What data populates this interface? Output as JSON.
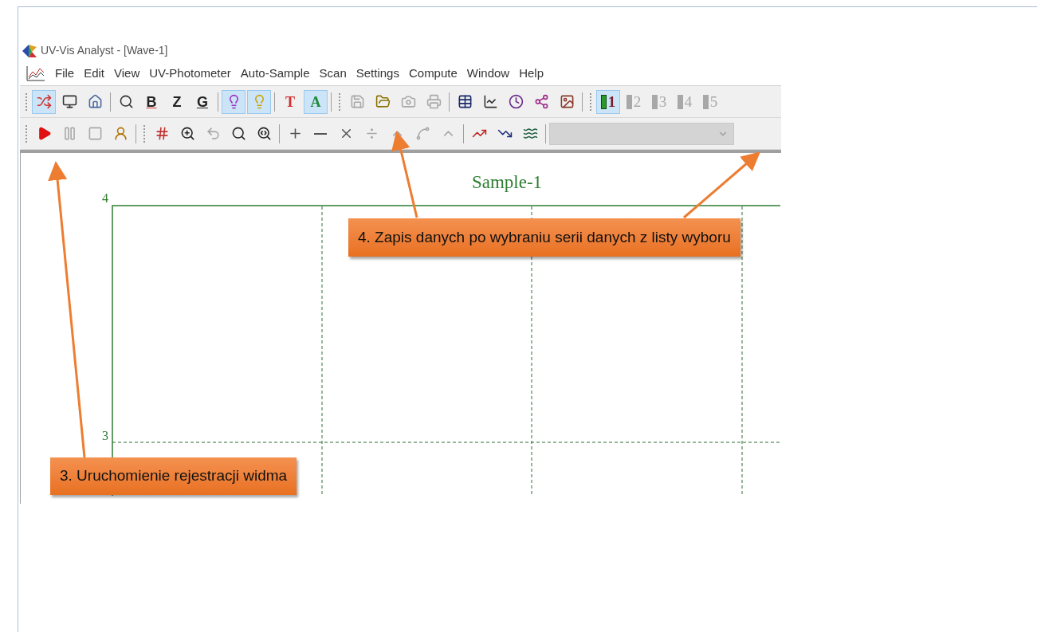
{
  "window": {
    "title": "UV-Vis Analyst - [Wave-1]"
  },
  "menu": [
    "File",
    "Edit",
    "View",
    "UV-Photometer",
    "Auto-Sample",
    "Scan",
    "Settings",
    "Compute",
    "Window",
    "Help"
  ],
  "toolbars": [
    {
      "groups": [
        {
          "grip": true,
          "items": [
            {
              "pressed": true,
              "disabled": false
            },
            {
              "pressed": false,
              "disabled": false
            },
            {
              "pressed": false,
              "disabled": false
            }
          ]
        },
        {
          "grip": false,
          "items": [
            {
              "pressed": false,
              "disabled": false
            },
            {
              "label": "B",
              "pressed": false,
              "disabled": false
            },
            {
              "label": "Z",
              "pressed": false,
              "disabled": false
            },
            {
              "label": "G",
              "pressed": false,
              "disabled": false
            }
          ]
        },
        {
          "grip": false,
          "items": [
            {
              "pressed": true,
              "disabled": false
            },
            {
              "pressed": true,
              "disabled": false
            }
          ]
        },
        {
          "grip": false,
          "items": [
            {
              "label": "T",
              "pressed": false,
              "disabled": false
            },
            {
              "label": "A",
              "pressed": true,
              "disabled": false
            }
          ]
        },
        {
          "grip": true,
          "items": [
            {
              "pressed": false,
              "disabled": true
            },
            {
              "pressed": false,
              "disabled": false
            },
            {
              "pressed": false,
              "disabled": true
            },
            {
              "pressed": false,
              "disabled": true
            }
          ]
        },
        {
          "grip": false,
          "items": [
            {
              "pressed": false,
              "disabled": false
            },
            {
              "pressed": false,
              "disabled": false
            },
            {
              "pressed": false,
              "disabled": false
            },
            {
              "pressed": false,
              "disabled": false
            },
            {
              "pressed": false,
              "disabled": false
            }
          ]
        },
        {
          "grip": true,
          "items": [
            {
              "label": "1",
              "pressed": true,
              "disabled": false
            },
            {
              "label": "2",
              "pressed": false,
              "disabled": true
            },
            {
              "label": "3",
              "pressed": false,
              "disabled": true
            },
            {
              "label": "4",
              "pressed": false,
              "disabled": true
            },
            {
              "label": "5",
              "pressed": false,
              "disabled": true
            }
          ]
        }
      ]
    },
    {
      "groups": [
        {
          "grip": true,
          "items": [
            {
              "pressed": false,
              "disabled": false
            },
            {
              "pressed": false,
              "disabled": true
            },
            {
              "pressed": false,
              "disabled": true
            },
            {
              "pressed": false,
              "disabled": false
            }
          ]
        },
        {
          "grip": true,
          "items": [
            {
              "pressed": false,
              "disabled": false
            },
            {
              "pressed": false,
              "disabled": false
            },
            {
              "pressed": false,
              "disabled": true
            },
            {
              "pressed": false,
              "disabled": false
            },
            {
              "pressed": false,
              "disabled": false
            }
          ]
        },
        {
          "grip": false,
          "items": [
            {
              "pressed": false,
              "disabled": false
            },
            {
              "pressed": false,
              "disabled": false
            },
            {
              "pressed": false,
              "disabled": false
            },
            {
              "pressed": false,
              "disabled": true
            },
            {
              "pressed": false,
              "disabled": true
            },
            {
              "pressed": false,
              "disabled": true
            },
            {
              "pressed": false,
              "disabled": true
            }
          ]
        },
        {
          "grip": false,
          "items": [
            {
              "pressed": false,
              "disabled": false
            },
            {
              "pressed": false,
              "disabled": false
            },
            {
              "pressed": false,
              "disabled": false
            }
          ]
        }
      ],
      "series_select": {
        "disabled": true
      }
    }
  ],
  "plot": {
    "title": "Sample-1",
    "y_ticks": [
      "4",
      "3"
    ]
  },
  "callouts": [
    {
      "text": "4. Zapis danych po wybraniu serii danych z listy wyboru"
    },
    {
      "text": "3. Uruchomienie rejestracji widma"
    }
  ]
}
